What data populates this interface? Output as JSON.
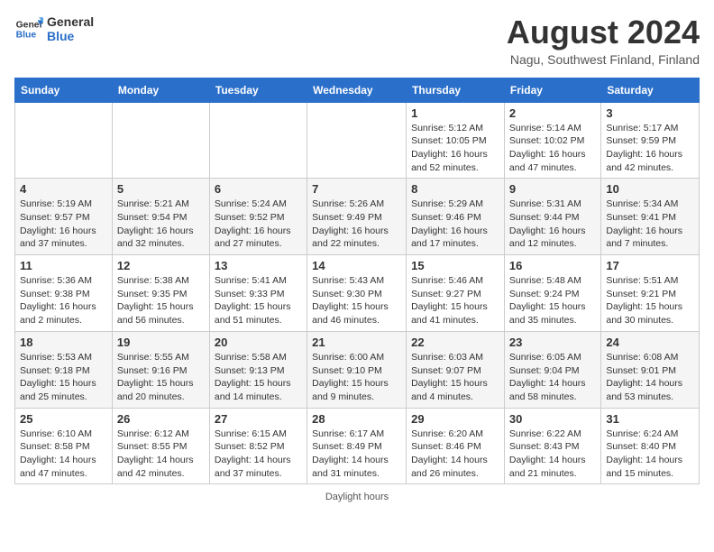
{
  "header": {
    "logo_general": "General",
    "logo_blue": "Blue",
    "month_year": "August 2024",
    "location": "Nagu, Southwest Finland, Finland"
  },
  "days_of_week": [
    "Sunday",
    "Monday",
    "Tuesday",
    "Wednesday",
    "Thursday",
    "Friday",
    "Saturday"
  ],
  "weeks": [
    [
      {
        "day": "",
        "info": ""
      },
      {
        "day": "",
        "info": ""
      },
      {
        "day": "",
        "info": ""
      },
      {
        "day": "",
        "info": ""
      },
      {
        "day": "1",
        "info": "Sunrise: 5:12 AM\nSunset: 10:05 PM\nDaylight: 16 hours\nand 52 minutes."
      },
      {
        "day": "2",
        "info": "Sunrise: 5:14 AM\nSunset: 10:02 PM\nDaylight: 16 hours\nand 47 minutes."
      },
      {
        "day": "3",
        "info": "Sunrise: 5:17 AM\nSunset: 9:59 PM\nDaylight: 16 hours\nand 42 minutes."
      }
    ],
    [
      {
        "day": "4",
        "info": "Sunrise: 5:19 AM\nSunset: 9:57 PM\nDaylight: 16 hours\nand 37 minutes."
      },
      {
        "day": "5",
        "info": "Sunrise: 5:21 AM\nSunset: 9:54 PM\nDaylight: 16 hours\nand 32 minutes."
      },
      {
        "day": "6",
        "info": "Sunrise: 5:24 AM\nSunset: 9:52 PM\nDaylight: 16 hours\nand 27 minutes."
      },
      {
        "day": "7",
        "info": "Sunrise: 5:26 AM\nSunset: 9:49 PM\nDaylight: 16 hours\nand 22 minutes."
      },
      {
        "day": "8",
        "info": "Sunrise: 5:29 AM\nSunset: 9:46 PM\nDaylight: 16 hours\nand 17 minutes."
      },
      {
        "day": "9",
        "info": "Sunrise: 5:31 AM\nSunset: 9:44 PM\nDaylight: 16 hours\nand 12 minutes."
      },
      {
        "day": "10",
        "info": "Sunrise: 5:34 AM\nSunset: 9:41 PM\nDaylight: 16 hours\nand 7 minutes."
      }
    ],
    [
      {
        "day": "11",
        "info": "Sunrise: 5:36 AM\nSunset: 9:38 PM\nDaylight: 16 hours\nand 2 minutes."
      },
      {
        "day": "12",
        "info": "Sunrise: 5:38 AM\nSunset: 9:35 PM\nDaylight: 15 hours\nand 56 minutes."
      },
      {
        "day": "13",
        "info": "Sunrise: 5:41 AM\nSunset: 9:33 PM\nDaylight: 15 hours\nand 51 minutes."
      },
      {
        "day": "14",
        "info": "Sunrise: 5:43 AM\nSunset: 9:30 PM\nDaylight: 15 hours\nand 46 minutes."
      },
      {
        "day": "15",
        "info": "Sunrise: 5:46 AM\nSunset: 9:27 PM\nDaylight: 15 hours\nand 41 minutes."
      },
      {
        "day": "16",
        "info": "Sunrise: 5:48 AM\nSunset: 9:24 PM\nDaylight: 15 hours\nand 35 minutes."
      },
      {
        "day": "17",
        "info": "Sunrise: 5:51 AM\nSunset: 9:21 PM\nDaylight: 15 hours\nand 30 minutes."
      }
    ],
    [
      {
        "day": "18",
        "info": "Sunrise: 5:53 AM\nSunset: 9:18 PM\nDaylight: 15 hours\nand 25 minutes."
      },
      {
        "day": "19",
        "info": "Sunrise: 5:55 AM\nSunset: 9:16 PM\nDaylight: 15 hours\nand 20 minutes."
      },
      {
        "day": "20",
        "info": "Sunrise: 5:58 AM\nSunset: 9:13 PM\nDaylight: 15 hours\nand 14 minutes."
      },
      {
        "day": "21",
        "info": "Sunrise: 6:00 AM\nSunset: 9:10 PM\nDaylight: 15 hours\nand 9 minutes."
      },
      {
        "day": "22",
        "info": "Sunrise: 6:03 AM\nSunset: 9:07 PM\nDaylight: 15 hours\nand 4 minutes."
      },
      {
        "day": "23",
        "info": "Sunrise: 6:05 AM\nSunset: 9:04 PM\nDaylight: 14 hours\nand 58 minutes."
      },
      {
        "day": "24",
        "info": "Sunrise: 6:08 AM\nSunset: 9:01 PM\nDaylight: 14 hours\nand 53 minutes."
      }
    ],
    [
      {
        "day": "25",
        "info": "Sunrise: 6:10 AM\nSunset: 8:58 PM\nDaylight: 14 hours\nand 47 minutes."
      },
      {
        "day": "26",
        "info": "Sunrise: 6:12 AM\nSunset: 8:55 PM\nDaylight: 14 hours\nand 42 minutes."
      },
      {
        "day": "27",
        "info": "Sunrise: 6:15 AM\nSunset: 8:52 PM\nDaylight: 14 hours\nand 37 minutes."
      },
      {
        "day": "28",
        "info": "Sunrise: 6:17 AM\nSunset: 8:49 PM\nDaylight: 14 hours\nand 31 minutes."
      },
      {
        "day": "29",
        "info": "Sunrise: 6:20 AM\nSunset: 8:46 PM\nDaylight: 14 hours\nand 26 minutes."
      },
      {
        "day": "30",
        "info": "Sunrise: 6:22 AM\nSunset: 8:43 PM\nDaylight: 14 hours\nand 21 minutes."
      },
      {
        "day": "31",
        "info": "Sunrise: 6:24 AM\nSunset: 8:40 PM\nDaylight: 14 hours\nand 15 minutes."
      }
    ]
  ],
  "footer": {
    "label": "Daylight hours"
  }
}
